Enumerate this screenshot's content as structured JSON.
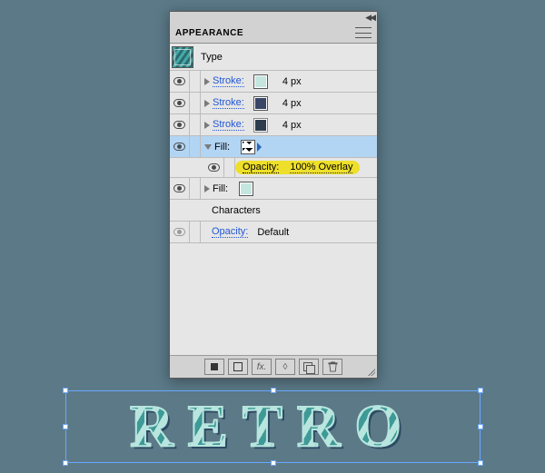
{
  "panel": {
    "title": "APPEARANCE",
    "type_thumb_label": "Type",
    "rows": {
      "stroke1": {
        "label": "Stroke:",
        "value": "4 px",
        "swatch": "#c5e6df"
      },
      "stroke2": {
        "label": "Stroke:",
        "value": "4 px",
        "swatch": "#394667"
      },
      "stroke3": {
        "label": "Stroke:",
        "value": "4 px",
        "swatch": "#2e3c4e"
      },
      "fill1": {
        "label": "Fill:"
      },
      "opacity_row": {
        "label": "Opacity:",
        "value": "100% Overlay"
      },
      "fill2": {
        "label": "Fill:",
        "swatch": "#c5e6df"
      },
      "characters": "Characters",
      "opacity_bottom": {
        "label": "Opacity:",
        "value": "Default"
      }
    },
    "footer": {
      "fx_label": "fx.",
      "clear_label": "◊"
    }
  },
  "artwork": {
    "text": "RETRO"
  }
}
